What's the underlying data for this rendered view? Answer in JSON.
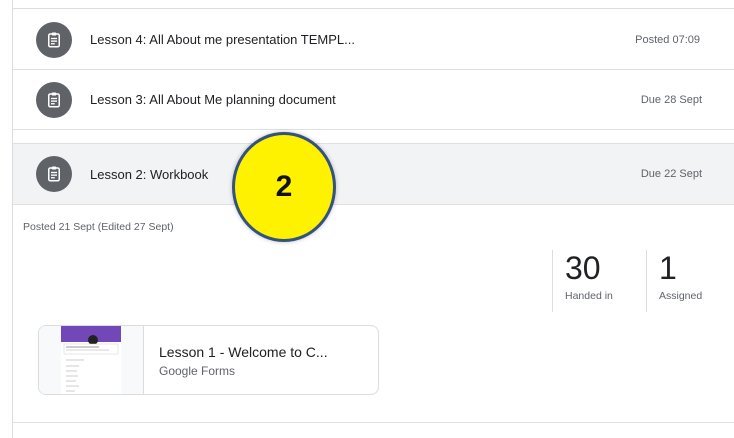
{
  "rows": [
    {
      "title": "Lesson 4: All About me presentation TEMPL...",
      "meta": "Posted 07:09"
    },
    {
      "title": "Lesson 3: All About Me planning document",
      "meta": "Due 28 Sept"
    },
    {
      "title": "Lesson 2: Workbook",
      "meta": "Due 22 Sept"
    }
  ],
  "expanded": {
    "posted": "Posted 21 Sept (Edited 27 Sept)",
    "stats": [
      {
        "value": "30",
        "label": "Handed in"
      },
      {
        "value": "1",
        "label": "Assigned"
      }
    ],
    "attachment": {
      "title": "Lesson 1 - Welcome to C...",
      "subtitle": "Google Forms"
    }
  },
  "callout": {
    "number": "2"
  },
  "icons": {
    "row_icon": "assignment-icon"
  },
  "colors": {
    "icon_badge": "#5f6368",
    "callout_fill": "#fff200",
    "callout_ring": "#33527d",
    "form_purple": "#7248b9"
  }
}
